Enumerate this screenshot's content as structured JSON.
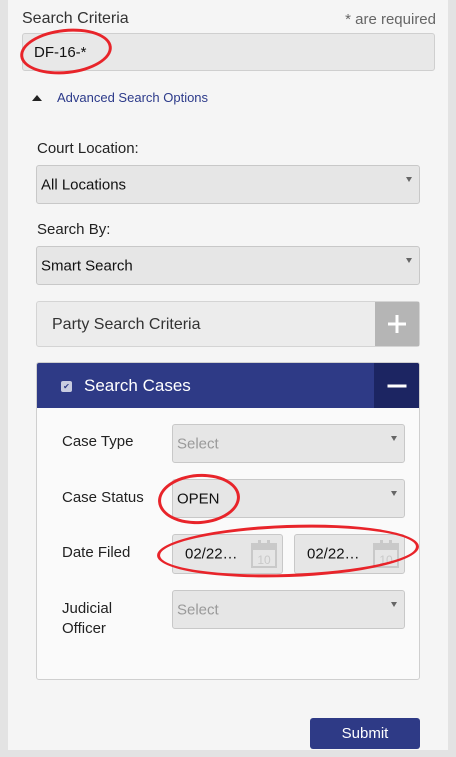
{
  "header": {
    "title": "Search Criteria",
    "required_note": "* are required"
  },
  "search": {
    "value": "DF-16-*"
  },
  "advanced": {
    "label": "Advanced Search Options"
  },
  "court_location": {
    "label": "Court Location:",
    "value": "All Locations"
  },
  "search_by": {
    "label": "Search By:",
    "value": "Smart Search"
  },
  "party_panel": {
    "title": "Party Search Criteria"
  },
  "cases_panel": {
    "title": "Search Cases",
    "case_type": {
      "label": "Case Type",
      "value": "Select"
    },
    "case_status": {
      "label": "Case Status",
      "value": "OPEN"
    },
    "date_filed": {
      "label": "Date Filed",
      "from": "02/22…",
      "to": "02/22…",
      "calendar_day": "10"
    },
    "judicial_officer": {
      "label_line1": "Judicial",
      "label_line2": "Officer",
      "value": "Select"
    }
  },
  "submit": {
    "label": "Submit"
  },
  "colors": {
    "accent": "#2e3a86",
    "highlight": "#e8242a"
  }
}
